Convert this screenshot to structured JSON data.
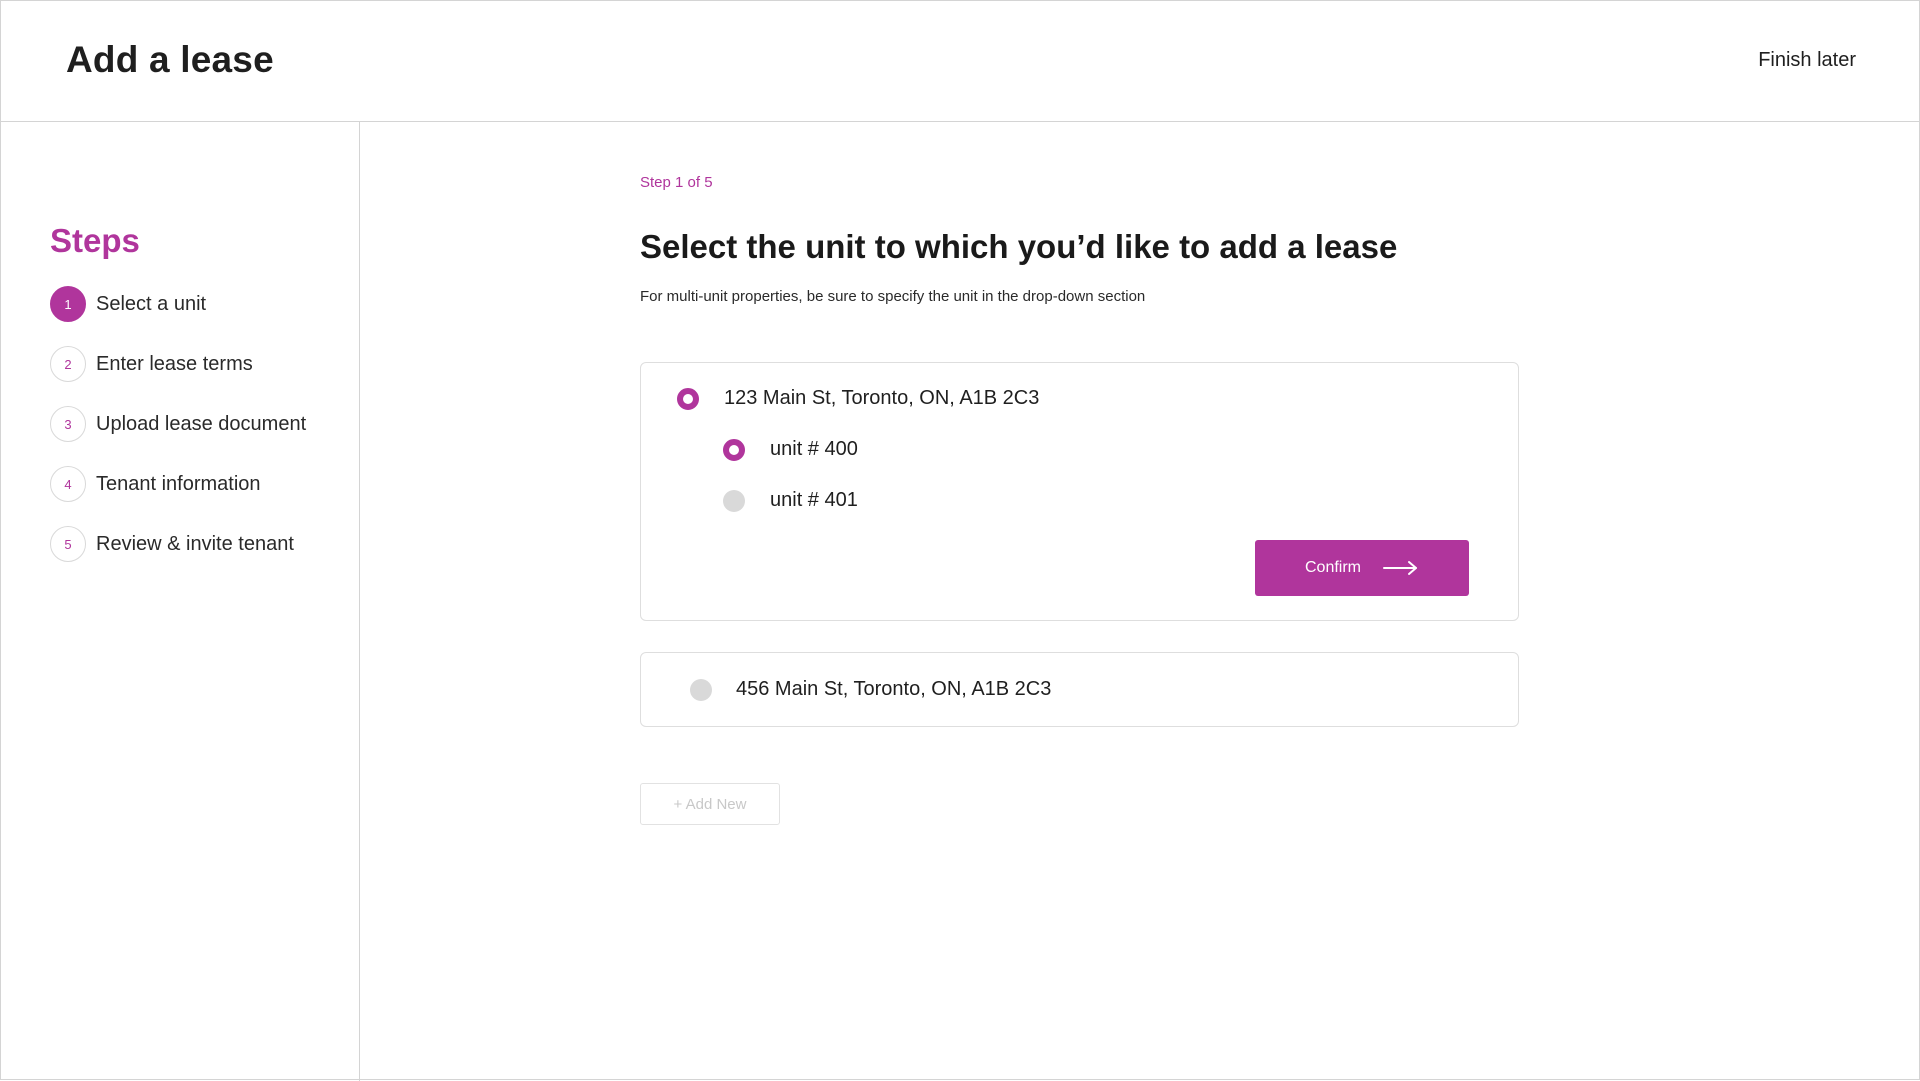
{
  "header": {
    "title": "Add a lease",
    "finish_later": "Finish later"
  },
  "sidebar": {
    "title": "Steps",
    "steps": [
      {
        "number": "1",
        "label": "Select a unit",
        "active": true
      },
      {
        "number": "2",
        "label": "Enter lease terms",
        "active": false
      },
      {
        "number": "3",
        "label": "Upload lease document",
        "active": false
      },
      {
        "number": "4",
        "label": "Tenant information",
        "active": false
      },
      {
        "number": "5",
        "label": "Review & invite tenant",
        "active": false
      }
    ]
  },
  "main": {
    "step_indicator": "Step 1 of 5",
    "heading": "Select the unit to which you’d like to add a lease",
    "subtext": "For multi-unit properties, be sure to specify the unit in the drop-down section",
    "properties": [
      {
        "address": "123 Main St, Toronto, ON, A1B 2C3",
        "selected": true,
        "units": [
          {
            "label": "unit # 400",
            "selected": true
          },
          {
            "label": "unit # 401",
            "selected": false
          }
        ],
        "confirm_label": "Confirm"
      },
      {
        "address": "456 Main St, Toronto, ON, A1B 2C3",
        "selected": false
      }
    ],
    "add_new_label": "+ Add New"
  },
  "colors": {
    "accent": "#b0359c",
    "border": "#d4d4d4",
    "radio_unselected": "#d9d9d9"
  },
  "icons": {
    "confirm_arrow": "arrow-right-icon"
  }
}
